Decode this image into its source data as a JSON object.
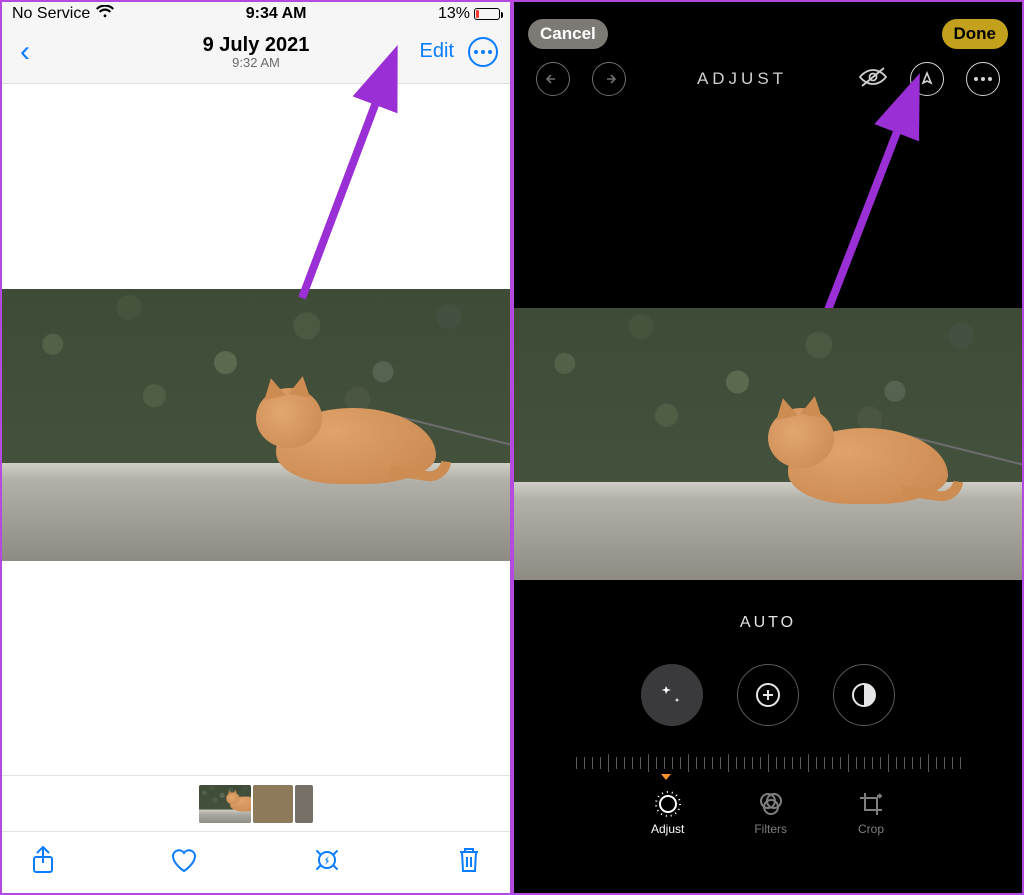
{
  "left": {
    "status": {
      "carrier": "No Service",
      "time": "9:34 AM",
      "battery_pct": "13%"
    },
    "nav": {
      "back_glyph": "‹",
      "date": "9 July 2021",
      "time": "9:32 AM",
      "edit": "Edit"
    },
    "toolbar": {
      "share_icon": "share-icon",
      "favorite_icon": "heart-icon",
      "live_icon": "live-photo-icon",
      "delete_icon": "trash-icon"
    }
  },
  "right": {
    "cancel": "Cancel",
    "done": "Done",
    "title": "ADJUST",
    "auto_label": "AUTO",
    "effects": [
      "auto-enhance",
      "exposure",
      "brilliance"
    ],
    "tabs": {
      "adjust": "Adjust",
      "filters": "Filters",
      "crop": "Crop"
    }
  }
}
